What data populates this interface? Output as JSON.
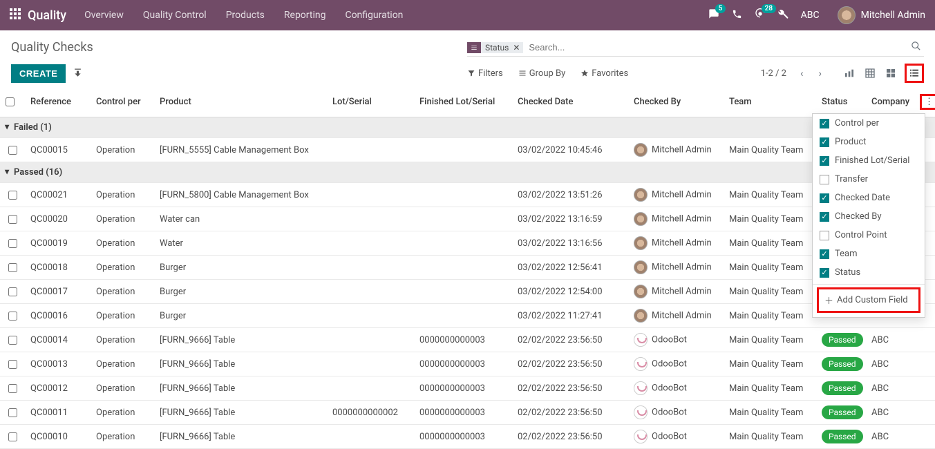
{
  "nav": {
    "brand": "Quality",
    "links": [
      "Overview",
      "Quality Control",
      "Products",
      "Reporting",
      "Configuration"
    ],
    "msg_badge": "5",
    "clock_badge": "28",
    "company_abbr": "ABC",
    "user": "Mitchell Admin"
  },
  "breadcrumb_title": "Quality Checks",
  "create_label": "CREATE",
  "search": {
    "facet_label": "Status",
    "placeholder": "Search..."
  },
  "toolbar": {
    "filters": "Filters",
    "groupby": "Group By",
    "favorites": "Favorites",
    "pager": "1-2 / 2"
  },
  "columns": {
    "reference": "Reference",
    "control_per": "Control per",
    "product": "Product",
    "lot": "Lot/Serial",
    "finished_lot": "Finished Lot/Serial",
    "checked_date": "Checked Date",
    "checked_by": "Checked By",
    "team": "Team",
    "status": "Status",
    "company": "Company"
  },
  "groups": [
    {
      "title": "Failed (1)",
      "rows": [
        {
          "ref": "QC00015",
          "ctrl": "Operation",
          "prod": "[FURN_5555] Cable Management Box",
          "lot": "",
          "flot": "",
          "date": "03/02/2022 10:45:46",
          "by": "Mitchell Admin",
          "bot": false,
          "team": "Main Quality Team",
          "status": "",
          "company": ""
        }
      ]
    },
    {
      "title": "Passed (16)",
      "rows": [
        {
          "ref": "QC00021",
          "ctrl": "Operation",
          "prod": "[FURN_5800] Cable Management Box",
          "lot": "",
          "flot": "",
          "date": "03/02/2022 13:51:26",
          "by": "Mitchell Admin",
          "bot": false,
          "team": "Main Quality Team",
          "status": "",
          "company": ""
        },
        {
          "ref": "QC00020",
          "ctrl": "Operation",
          "prod": "Water can",
          "lot": "",
          "flot": "",
          "date": "03/02/2022 13:16:59",
          "by": "Mitchell Admin",
          "bot": false,
          "team": "Main Quality Team",
          "status": "",
          "company": ""
        },
        {
          "ref": "QC00019",
          "ctrl": "Operation",
          "prod": "Water",
          "lot": "",
          "flot": "",
          "date": "03/02/2022 13:16:56",
          "by": "Mitchell Admin",
          "bot": false,
          "team": "Main Quality Team",
          "status": "",
          "company": ""
        },
        {
          "ref": "QC00018",
          "ctrl": "Operation",
          "prod": "Burger",
          "lot": "",
          "flot": "",
          "date": "03/02/2022 12:56:41",
          "by": "Mitchell Admin",
          "bot": false,
          "team": "Main Quality Team",
          "status": "",
          "company": ""
        },
        {
          "ref": "QC00017",
          "ctrl": "Operation",
          "prod": "Burger",
          "lot": "",
          "flot": "",
          "date": "03/02/2022 12:54:00",
          "by": "Mitchell Admin",
          "bot": false,
          "team": "Main Quality Team",
          "status": "",
          "company": ""
        },
        {
          "ref": "QC00016",
          "ctrl": "Operation",
          "prod": "Burger",
          "lot": "",
          "flot": "",
          "date": "03/02/2022 11:27:41",
          "by": "Mitchell Admin",
          "bot": false,
          "team": "Main Quality Team",
          "status": "",
          "company": ""
        },
        {
          "ref": "QC00014",
          "ctrl": "Operation",
          "prod": "[FURN_9666] Table",
          "lot": "",
          "flot": "0000000000003",
          "date": "02/02/2022 23:56:50",
          "by": "OdooBot",
          "bot": true,
          "team": "Main Quality Team",
          "status": "Passed",
          "company": "ABC"
        },
        {
          "ref": "QC00013",
          "ctrl": "Operation",
          "prod": "[FURN_9666] Table",
          "lot": "",
          "flot": "0000000000003",
          "date": "02/02/2022 23:56:50",
          "by": "OdooBot",
          "bot": true,
          "team": "Main Quality Team",
          "status": "Passed",
          "company": "ABC"
        },
        {
          "ref": "QC00012",
          "ctrl": "Operation",
          "prod": "[FURN_9666] Table",
          "lot": "",
          "flot": "0000000000003",
          "date": "02/02/2022 23:56:50",
          "by": "OdooBot",
          "bot": true,
          "team": "Main Quality Team",
          "status": "Passed",
          "company": "ABC"
        },
        {
          "ref": "QC00011",
          "ctrl": "Operation",
          "prod": "[FURN_9666] Table",
          "lot": "0000000000002",
          "flot": "0000000000003",
          "date": "02/02/2022 23:56:50",
          "by": "OdooBot",
          "bot": true,
          "team": "Main Quality Team",
          "status": "Passed",
          "company": "ABC"
        },
        {
          "ref": "QC00010",
          "ctrl": "Operation",
          "prod": "[FURN_9666] Table",
          "lot": "",
          "flot": "0000000000003",
          "date": "02/02/2022 23:56:50",
          "by": "OdooBot",
          "bot": true,
          "team": "Main Quality Team",
          "status": "Passed",
          "company": "ABC"
        }
      ]
    }
  ],
  "dropdown": {
    "items": [
      {
        "label": "Control per",
        "on": true
      },
      {
        "label": "Product",
        "on": true
      },
      {
        "label": "Finished Lot/Serial",
        "on": true
      },
      {
        "label": "Transfer",
        "on": false
      },
      {
        "label": "Checked Date",
        "on": true
      },
      {
        "label": "Checked By",
        "on": true
      },
      {
        "label": "Control Point",
        "on": false
      },
      {
        "label": "Team",
        "on": true
      },
      {
        "label": "Status",
        "on": true
      }
    ],
    "add_custom": "Add Custom Field"
  }
}
